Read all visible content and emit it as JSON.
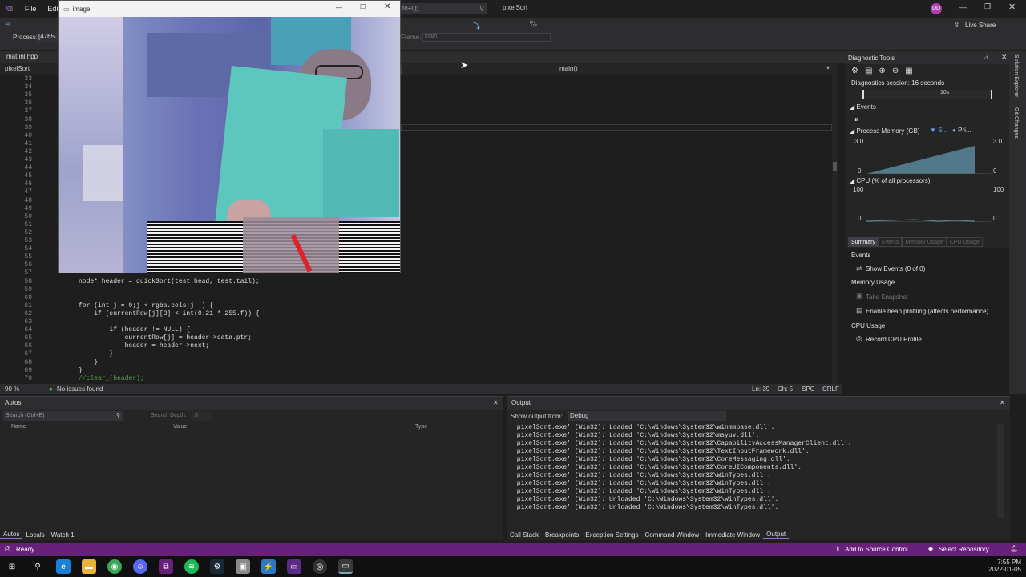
{
  "titlebar": {
    "menu": [
      "File",
      "Edit"
    ],
    "search_hint": "trl+Q)",
    "app_title": "pixelSort",
    "avatar": "DD",
    "live_share": "Live Share"
  },
  "toolbar": {
    "process_label": "Process:",
    "process_value": "[4765",
    "frame_label": "Frame:",
    "frame_value": "main"
  },
  "doctabs": {
    "file_tab": "mat.inl.hpp",
    "project_dropdown": "pixelSort",
    "function_dropdown": "main()"
  },
  "image_window": {
    "title": "image"
  },
  "editor": {
    "line_numbers": [
      "33",
      "34",
      "35",
      "36",
      "37",
      "38",
      "39",
      "40",
      "41",
      "42",
      "43",
      "44",
      "45",
      "46",
      "47",
      "48",
      "49",
      "50",
      "51",
      "52",
      "53",
      "54",
      "55",
      "56",
      "57",
      "58",
      "59",
      "60",
      "61",
      "62",
      "63",
      "64",
      "65",
      "66",
      "67",
      "68",
      "69",
      "70"
    ],
    "code_lines": [
      {
        "n": 58,
        "text": "node* header = quickSort(test.head, test.tail);"
      },
      {
        "n": 61,
        "text": "for (int j = 0;j < rgba.cols;j++) {"
      },
      {
        "n": 62,
        "text": "    if (currentRow[j][3] < int(0.21 * 255.f)) {"
      },
      {
        "n": 64,
        "text": "        if (header != NULL) {"
      },
      {
        "n": 65,
        "text": "            currentRow[j] = header->data.ptr;"
      },
      {
        "n": 66,
        "text": "            header = header->next;"
      },
      {
        "n": 67,
        "text": "        }"
      },
      {
        "n": 68,
        "text": "    }"
      },
      {
        "n": 69,
        "text": "}"
      },
      {
        "n": 70,
        "text": "//clear_(header);"
      }
    ],
    "zoom": "90 %",
    "issues": "No issues found",
    "position": {
      "ln": "Ln: 39",
      "ch": "Ch: 5",
      "spc": "SPC",
      "crlf": "CRLF"
    }
  },
  "diagnostics": {
    "title": "Diagnostic Tools",
    "session": "Diagnostics session: 16 seconds",
    "timeline_tick": "10s",
    "events_header": "Events",
    "memory_header": "Process Memory (GB)",
    "memory_legend": [
      "S...",
      "Pri..."
    ],
    "memory_axis": {
      "top": "3.0",
      "bottom": "0"
    },
    "cpu_header": "CPU (% of all processors)",
    "cpu_axis": {
      "top": "100",
      "bottom": "0"
    },
    "tabs": [
      "Summary",
      "Events",
      "Memory Usage",
      "CPU Usage"
    ],
    "sections": {
      "events": "Events",
      "show_events": "Show Events (0 of 0)",
      "memory_usage": "Memory Usage",
      "take_snapshot": "Take Snapshot",
      "heap_profiling": "Enable heap profiling (affects performance)",
      "cpu_usage": "CPU Usage",
      "record_cpu": "Record CPU Profile"
    },
    "side_tabs": [
      "Solution Explorer",
      "Git Changes"
    ]
  },
  "autos": {
    "title": "Autos",
    "search_placeholder": "Search (Ctrl+E)",
    "search_depth_label": "Search Depth:",
    "search_depth_value": "3",
    "columns": [
      "Name",
      "Value",
      "Type"
    ],
    "bottom_tabs": [
      "Autos",
      "Locals",
      "Watch 1"
    ]
  },
  "output": {
    "title": "Output",
    "show_from_label": "Show output from:",
    "show_from_value": "Debug",
    "lines": [
      "'pixelSort.exe' (Win32): Loaded 'C:\\Windows\\System32\\winmmbase.dll'.",
      "'pixelSort.exe' (Win32): Loaded 'C:\\Windows\\System32\\msyuv.dll'.",
      "'pixelSort.exe' (Win32): Loaded 'C:\\Windows\\System32\\CapabilityAccessManagerClient.dll'.",
      "'pixelSort.exe' (Win32): Loaded 'C:\\Windows\\System32\\TextInputFramework.dll'.",
      "'pixelSort.exe' (Win32): Loaded 'C:\\Windows\\System32\\CoreMessaging.dll'.",
      "'pixelSort.exe' (Win32): Loaded 'C:\\Windows\\System32\\CoreUIComponents.dll'.",
      "'pixelSort.exe' (Win32): Loaded 'C:\\Windows\\System32\\WinTypes.dll'.",
      "'pixelSort.exe' (Win32): Loaded 'C:\\Windows\\System32\\WinTypes.dll'.",
      "'pixelSort.exe' (Win32): Loaded 'C:\\Windows\\System32\\WinTypes.dll'.",
      "'pixelSort.exe' (Win32): Unloaded 'C:\\Windows\\System32\\WinTypes.dll'.",
      "'pixelSort.exe' (Win32): Unloaded 'C:\\Windows\\System32\\WinTypes.dll'."
    ],
    "bottom_tabs": [
      "Call Stack",
      "Breakpoints",
      "Exception Settings",
      "Command Window",
      "Immediate Window",
      "Output"
    ]
  },
  "statusbar": {
    "ready": "Ready",
    "source_control": "Add to Source Control",
    "repository": "Select Repository"
  },
  "taskbar": {
    "time": "7:55 PM",
    "date": "2022-01-05"
  },
  "colors": {
    "accent": "#68217a",
    "statusbar": "#68217a",
    "editor_bg": "#1e1e1e",
    "panel_bg": "#252526"
  }
}
